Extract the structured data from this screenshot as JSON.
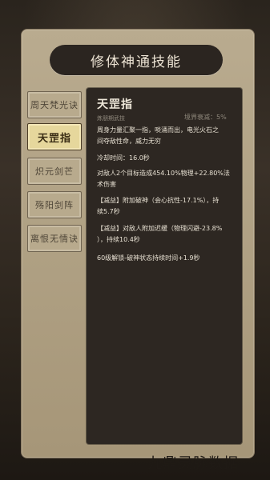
{
  "title": "修体神通技能",
  "skills": [
    "周天梵光诀",
    "天罡指",
    "炽元剑芒",
    "殇阳剑阵",
    "离恨无情诀"
  ],
  "detail": {
    "name": "天罡指",
    "category": "炼朋期武技",
    "realm": "境界衰减：5%",
    "desc_line1": "周身力量汇聚一指，啖涌而出，电光火石之",
    "desc_line2": "间夺敌性命，威力无穷",
    "cooldown": "冷却时间：16.0秒",
    "damage_line1": "对敌人2个目标造成454.10%物理+22.80%法",
    "damage_line2": "术伤害",
    "buff_line1": "【减益】附加破神（会心抗性-17.1%），持",
    "buff_line2": "续5.7秒",
    "debuff_line1": "【减益】对敌人附加迟缓（物理闪避-23.8%",
    "debuff_line2": "），持续10.4秒",
    "unlock": "60级解锁-破神状态持续时间+1.9秒"
  },
  "watermark": "九鼎灵脉数据"
}
